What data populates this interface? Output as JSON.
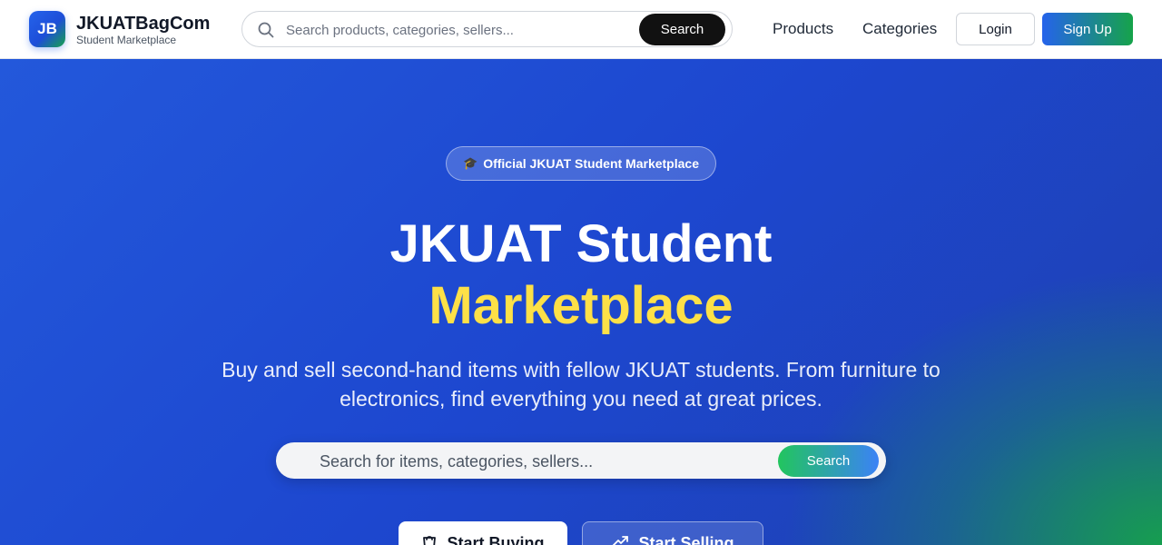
{
  "header": {
    "logo_initials": "JB",
    "brand_name": "JKUATBagCom",
    "brand_subtitle": "Student Marketplace",
    "search": {
      "placeholder": "Search products, categories, sellers...",
      "button_label": "Search",
      "icon": "search-icon"
    },
    "nav": {
      "products_label": "Products",
      "categories_label": "Categories"
    },
    "login_label": "Login",
    "signup_label": "Sign Up"
  },
  "hero": {
    "badge_icon": "🎓",
    "badge_text": "Official JKUAT Student Marketplace",
    "title_line1": "JKUAT Student",
    "title_line2": "Marketplace",
    "description": "Buy and sell second-hand items with fellow JKUAT students. From furniture to electronics, find everything you need at great prices.",
    "search": {
      "placeholder": "Search for items, categories, sellers...",
      "button_label": "Search"
    },
    "cta_buy": {
      "label": "Start Buying",
      "icon": "shopping-bag-icon"
    },
    "cta_sell": {
      "label": "Start Selling",
      "icon": "trending-up-icon"
    }
  },
  "colors": {
    "primary_blue": "#2563eb",
    "accent_green": "#16a34a",
    "highlight_yellow": "#fde047",
    "search_button_dark": "#111111"
  }
}
